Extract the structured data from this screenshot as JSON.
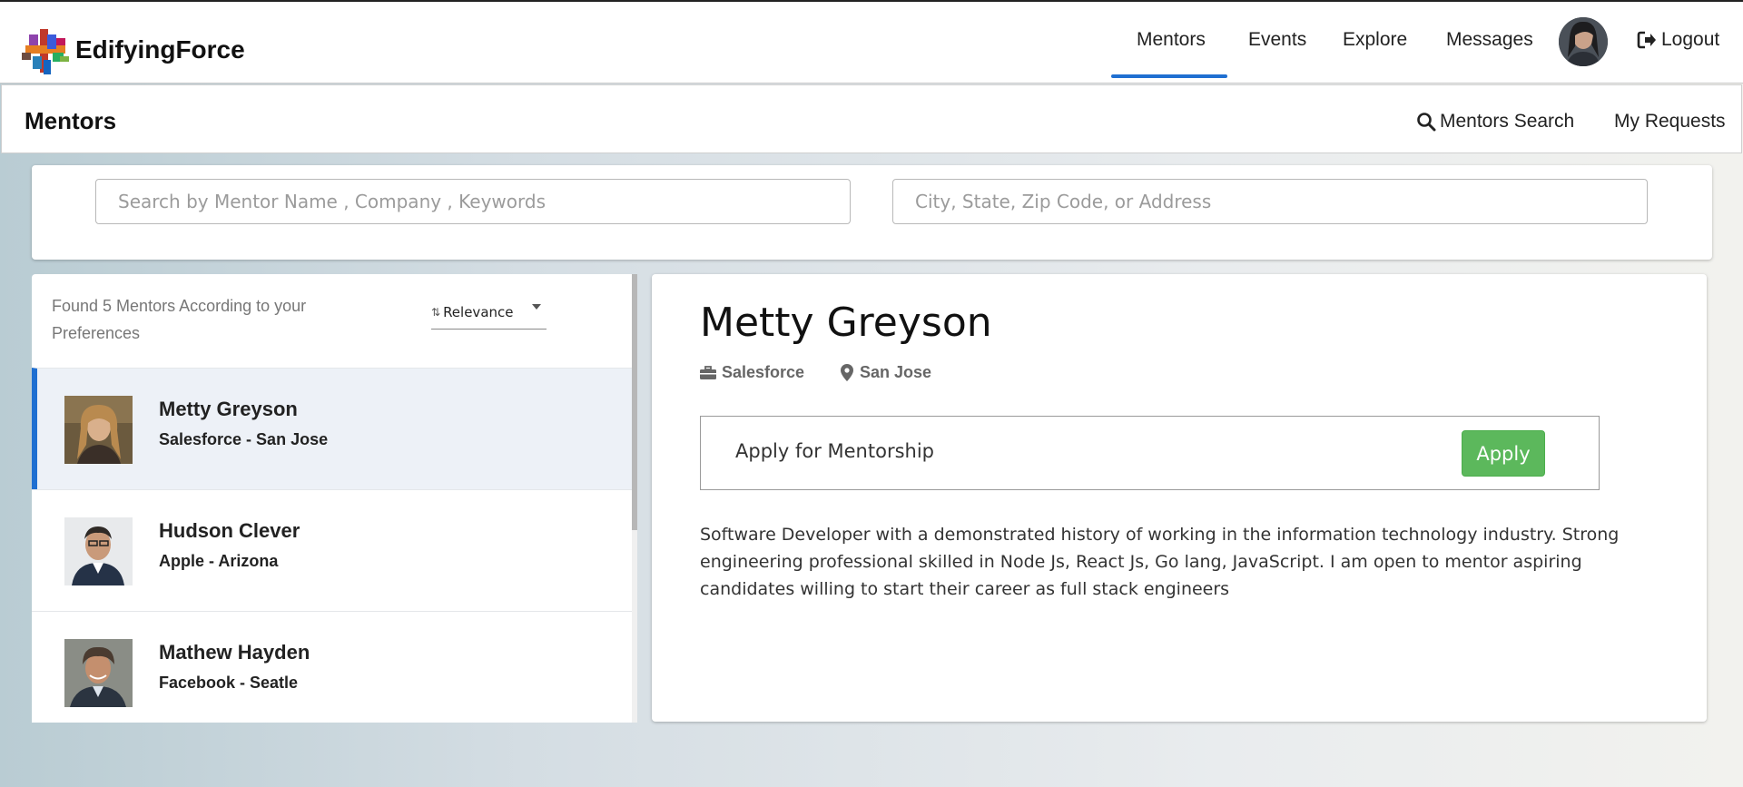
{
  "brand": {
    "name": "EdifyingForce"
  },
  "nav": {
    "items": [
      {
        "label": "Mentors",
        "active": true
      },
      {
        "label": "Events"
      },
      {
        "label": "Explore"
      },
      {
        "label": "Messages"
      }
    ],
    "logout_label": "Logout",
    "accent_color": "#1f6fd1"
  },
  "subheader": {
    "title": "Mentors",
    "search_link": "Mentors Search",
    "requests_link": "My Requests"
  },
  "search": {
    "keyword_placeholder": "Search by Mentor Name , Company , Keywords",
    "location_placeholder": "City, State, Zip Code, or Address"
  },
  "results": {
    "found_text": "Found 5 Mentors According to your Preferences",
    "sort_label": "Relevance",
    "sort_icon": "sort-icon"
  },
  "mentors": [
    {
      "name": "Metty Greyson",
      "subtitle": "Salesforce - San Jose",
      "selected": true
    },
    {
      "name": "Hudson Clever",
      "subtitle": "Apple - Arizona"
    },
    {
      "name": "Mathew Hayden",
      "subtitle": "Facebook - Seatle"
    }
  ],
  "detail": {
    "name": "Metty Greyson",
    "company": "Salesforce",
    "company_icon": "briefcase-icon",
    "location": "San Jose",
    "location_icon": "map-marker-icon",
    "apply_text": "Apply for Mentorship",
    "apply_button": "Apply",
    "apply_color": "#5cb85c",
    "bio": "Software Developer with a demonstrated history of working in the information technology industry. Strong engineering professional skilled in Node Js, React Js, Go lang, JavaScript. I am open to mentor aspiring candidates willing to start their career as full stack engineers"
  }
}
